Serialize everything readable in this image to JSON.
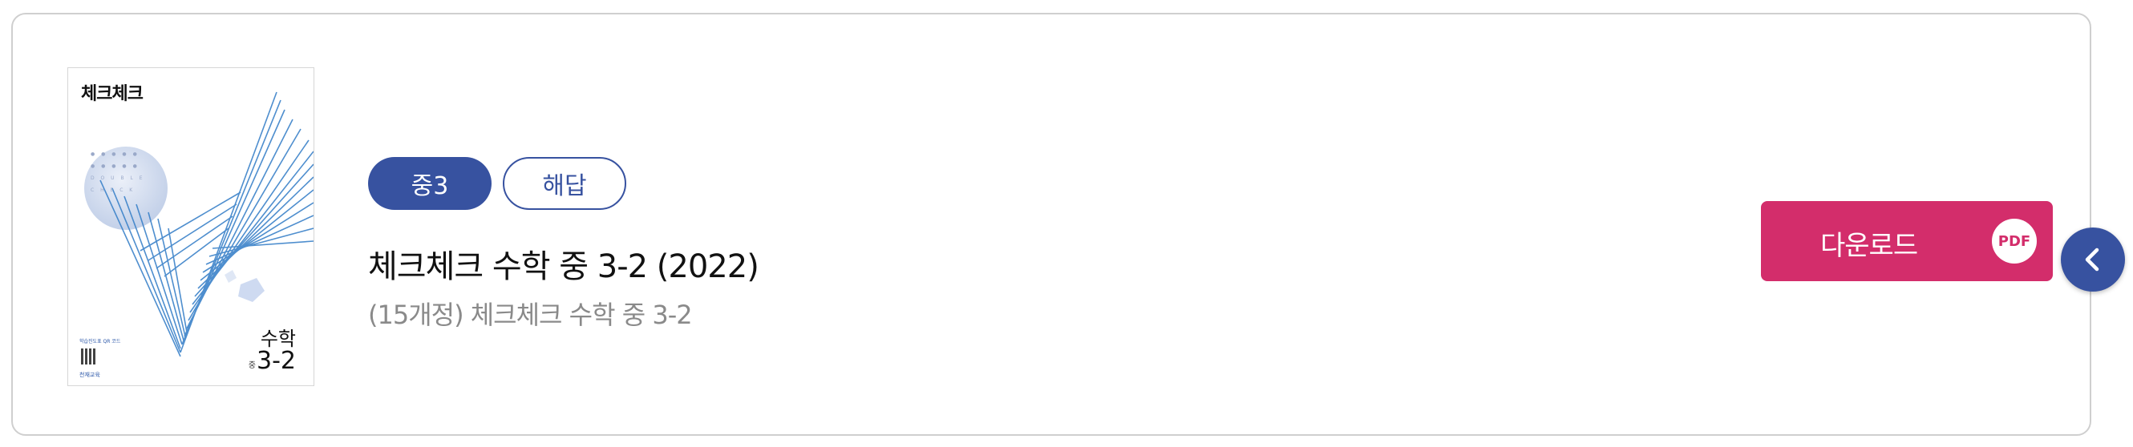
{
  "cover": {
    "brand": "체크체크",
    "subject": "수학",
    "grade_prefix": "중",
    "grade": "3-2",
    "qr_text": "학습진도표 QR 코드",
    "publisher": "천재교육",
    "dot_rows": [
      "● ● ● ● ●",
      "● ● ● ● ●",
      "D O U B L E",
      "C H E C K"
    ]
  },
  "badges": {
    "grade": "중3",
    "type": "해답"
  },
  "book": {
    "title": "체크체크 수학 중 3-2 (2022)",
    "subtitle": "(15개정) 체크체크 수학 중 3-2"
  },
  "download": {
    "label": "다운로드",
    "file_type": "PDF"
  },
  "icons": {
    "side_button": "chevron-left-icon"
  },
  "colors": {
    "primary_blue": "#3752a0",
    "download_pink": "#d32d6b",
    "subtitle_gray": "#8a8a8a"
  }
}
